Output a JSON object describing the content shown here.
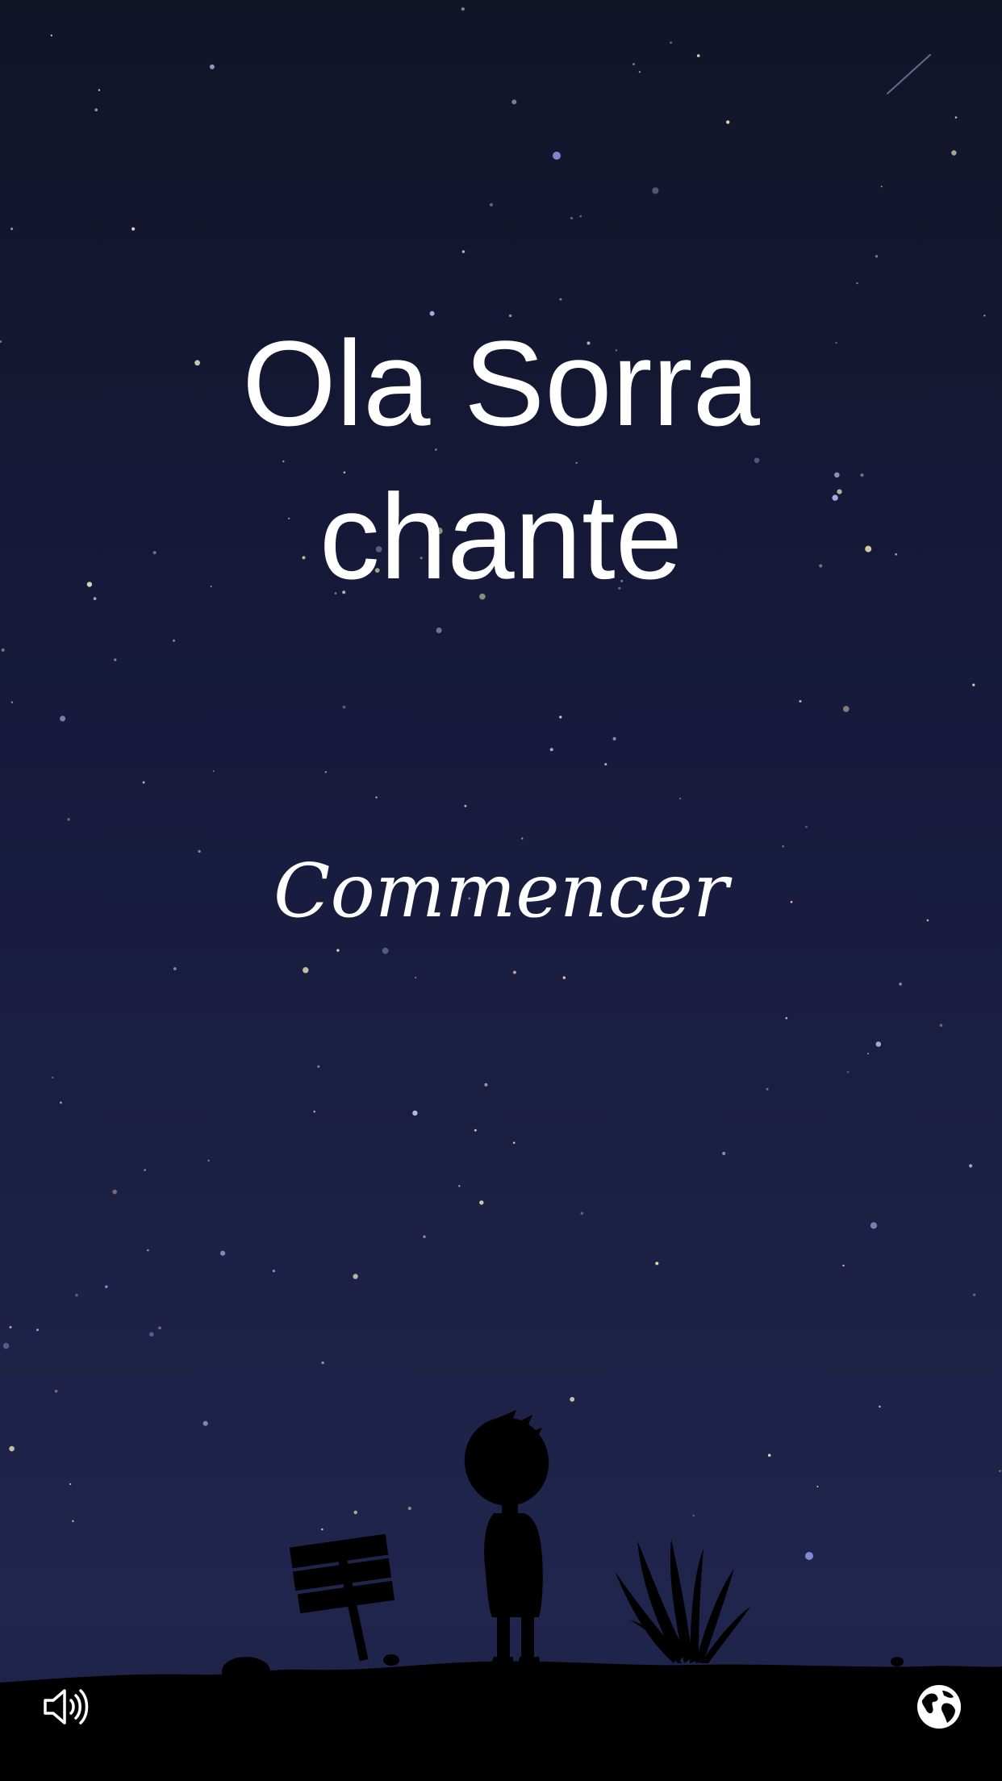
{
  "title": {
    "line1": "Ola Sorra",
    "line2": "chante"
  },
  "menu": {
    "start_label": "Commencer"
  },
  "icons": {
    "sound": "speaker-icon",
    "language": "globe-icon"
  },
  "colors": {
    "sky_top": "#121528",
    "sky_bottom": "#20254d",
    "text": "#ffffff",
    "silhouette": "#000000"
  }
}
